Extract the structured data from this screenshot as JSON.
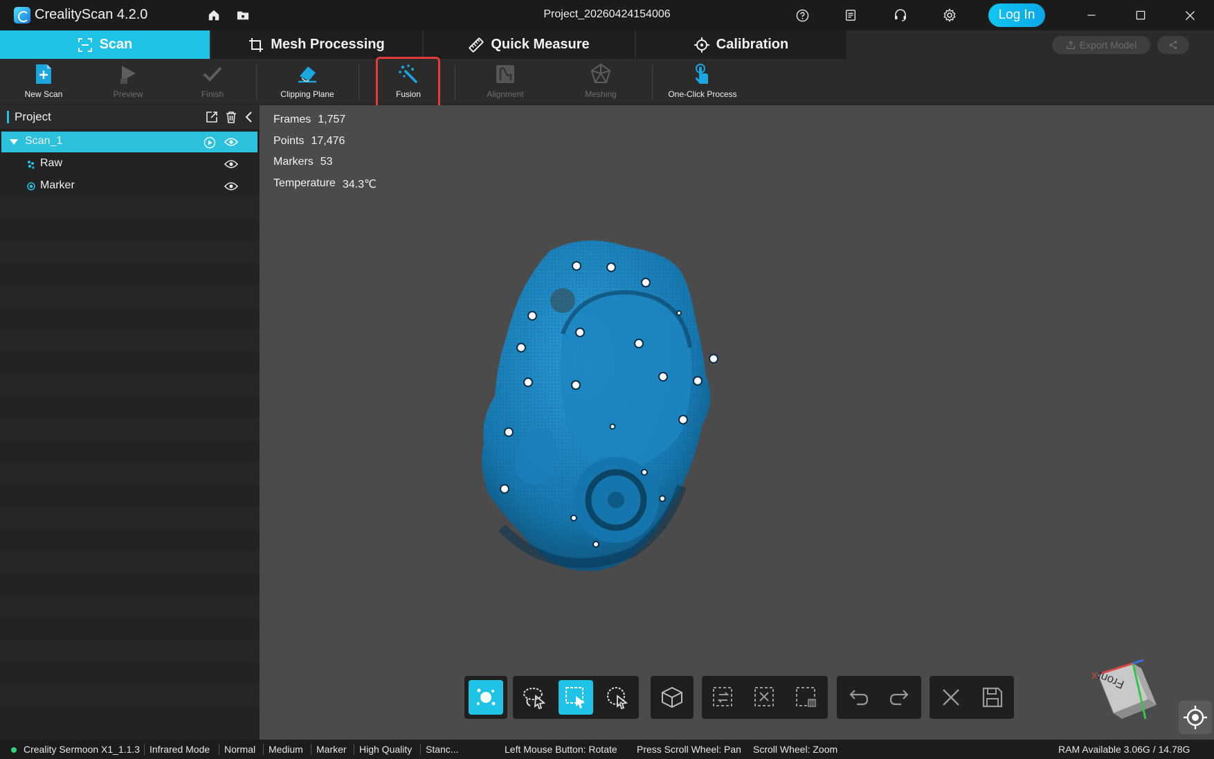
{
  "app": {
    "title": "CrealityScan 4.2.0",
    "project": "Project_20260424154006",
    "login": "Log In"
  },
  "tabs": [
    {
      "label": "Scan",
      "icon": "scan-frame-icon",
      "active": true
    },
    {
      "label": "Mesh Processing",
      "icon": "crop-icon"
    },
    {
      "label": "Quick Measure",
      "icon": "ruler-icon"
    },
    {
      "label": "Calibration",
      "icon": "crosshair-icon"
    }
  ],
  "export": {
    "label": "Export Model"
  },
  "toolbar": [
    {
      "label": "New Scan",
      "icon": "new-scan-icon",
      "enabled": true
    },
    {
      "label": "Preview",
      "icon": "play-icon",
      "enabled": false
    },
    {
      "label": "Finish",
      "icon": "check-icon",
      "enabled": false
    },
    {
      "label": "Clipping Plane",
      "icon": "eraser-icon",
      "enabled": true
    },
    {
      "label": "Fusion",
      "icon": "fusion-wand-icon",
      "enabled": true,
      "highlighted": true
    },
    {
      "label": "Alignment",
      "icon": "alignment-icon",
      "enabled": false
    },
    {
      "label": "Meshing",
      "icon": "mesh-icon",
      "enabled": false
    },
    {
      "label": "One-Click Process",
      "icon": "tap-icon",
      "enabled": true
    }
  ],
  "project_panel": {
    "title": "Project",
    "items": [
      {
        "label": "Scan_1",
        "selected": true
      },
      {
        "label": "Raw"
      },
      {
        "label": "Marker"
      }
    ]
  },
  "stats": [
    {
      "label": "Frames",
      "value": "1,757"
    },
    {
      "label": "Points",
      "value": "17,476"
    },
    {
      "label": "Markers",
      "value": "53"
    },
    {
      "label": "Temperature",
      "value": "34.3℃"
    }
  ],
  "navcube": {
    "face": "Front",
    "x_label": "X"
  },
  "status": {
    "device": "Creality Sermoon X1_1.1.3",
    "modes": [
      "Infrared Mode",
      "Normal",
      "Medium",
      "Marker",
      "High Quality",
      "Stanc..."
    ],
    "hints": [
      "Left Mouse Button: Rotate",
      "Press Scroll Wheel: Pan",
      "Scroll Wheel: Zoom"
    ],
    "ram": "RAM Available 3.06G / 14.78G"
  },
  "colors": {
    "accent": "#1ec3e6",
    "model": "#1a7fb8",
    "highlight": "#e53b3b"
  }
}
